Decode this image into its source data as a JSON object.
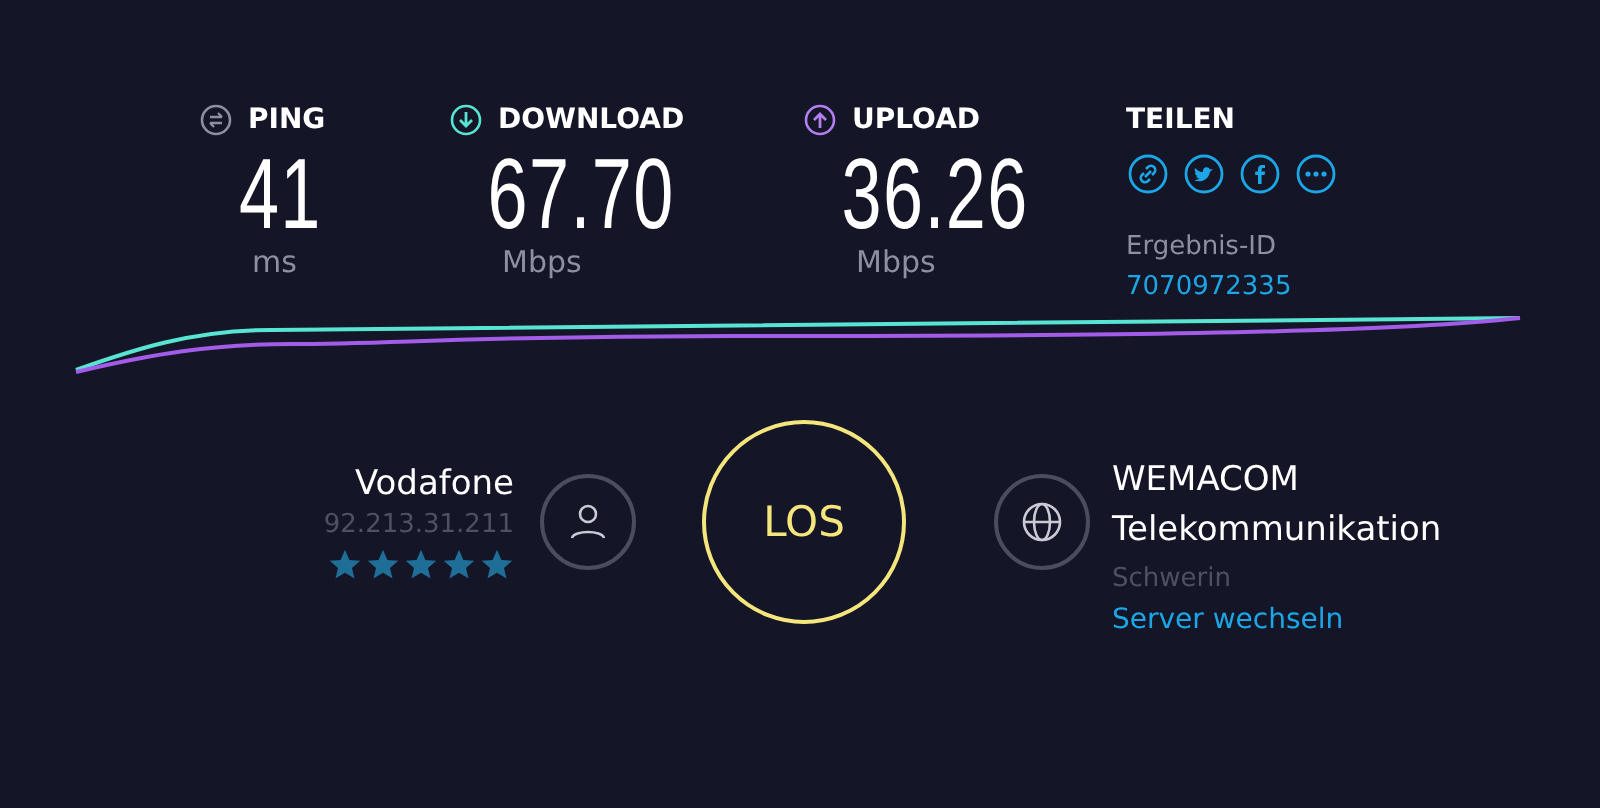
{
  "metrics": [
    {
      "kind": "ping",
      "label": "PING",
      "value": "41",
      "unit": "ms"
    },
    {
      "kind": "download",
      "label": "DOWNLOAD",
      "value": "67.70",
      "unit": "Mbps"
    },
    {
      "kind": "upload",
      "label": "UPLOAD",
      "value": "36.26",
      "unit": "Mbps"
    }
  ],
  "share": {
    "label": "TEILEN",
    "buttons": [
      {
        "kind": "link"
      },
      {
        "kind": "twitter"
      },
      {
        "kind": "facebook"
      },
      {
        "kind": "more"
      }
    ],
    "result_label": "Ergebnis-ID",
    "result_id": "7070972335"
  },
  "isp": {
    "name": "Vodafone",
    "ip": "92.213.31.211",
    "stars": 5
  },
  "go_button": "LOS",
  "server": {
    "name": "WEMACOM Telekommunikation",
    "location": "Schwerin",
    "change_link": "Server wechseln"
  }
}
